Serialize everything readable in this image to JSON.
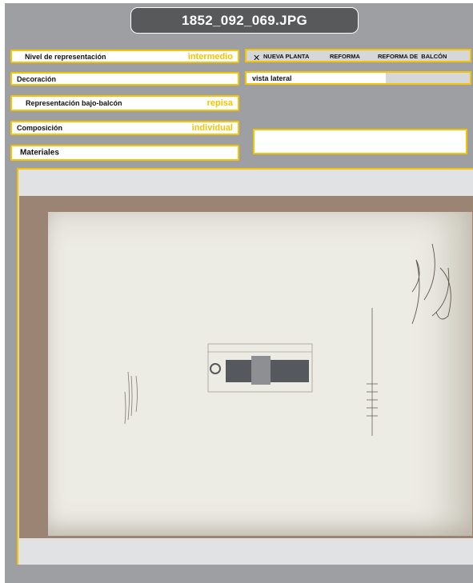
{
  "window": {
    "title": "1852_092_069.JPG"
  },
  "fields": {
    "nivel": {
      "label": "Nivel de representación",
      "value": "intermedio"
    },
    "decoracion": {
      "label": "Decoración"
    },
    "bajo_balcon": {
      "label": "Representación bajo-balcón",
      "value": "repisa"
    },
    "composicion": {
      "label": "Composición",
      "value": "individual"
    },
    "materiales": {
      "label": "Materiales"
    }
  },
  "type_options": {
    "checked_mark": "✕",
    "items": [
      "NUEVA PLANTA",
      "REFORMA",
      "REFORMA DE  BALCÓN"
    ]
  },
  "view": {
    "label": "vista lateral"
  },
  "colors": {
    "accent": "#f5c400",
    "panel": "#9d9fa2",
    "title_bg": "#58595b",
    "viewer_bg": "#e1e2e3"
  }
}
